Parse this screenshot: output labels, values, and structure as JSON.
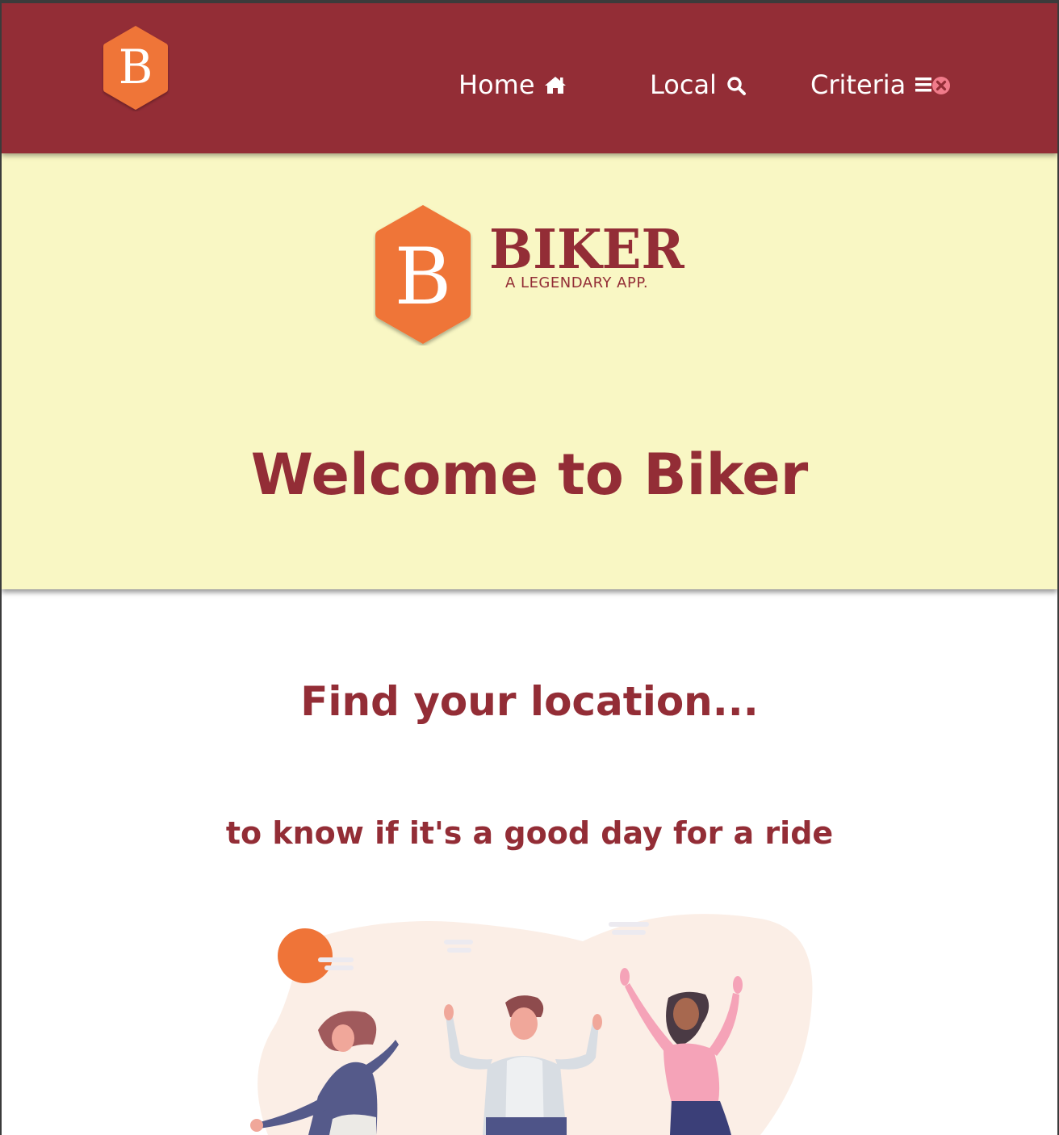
{
  "nav": {
    "logo_letter": "B",
    "items": [
      {
        "label": "Home",
        "icon": "home-icon"
      },
      {
        "label": "Local",
        "icon": "search-icon"
      },
      {
        "label": "Criteria",
        "icon": "filter-clear-icon"
      }
    ]
  },
  "hero": {
    "logo_letter": "B",
    "brand_name": "BIKER",
    "brand_tagline": "A LEGENDARY APP.",
    "title": "Welcome to Biker"
  },
  "content": {
    "heading": "Find your location...",
    "subheading": "to know if it's a good day for a ride"
  },
  "colors": {
    "primary": "#932d36",
    "accent": "#ef7438",
    "hero_bg": "#f9f7c4",
    "page_bg": "#ffffff"
  }
}
